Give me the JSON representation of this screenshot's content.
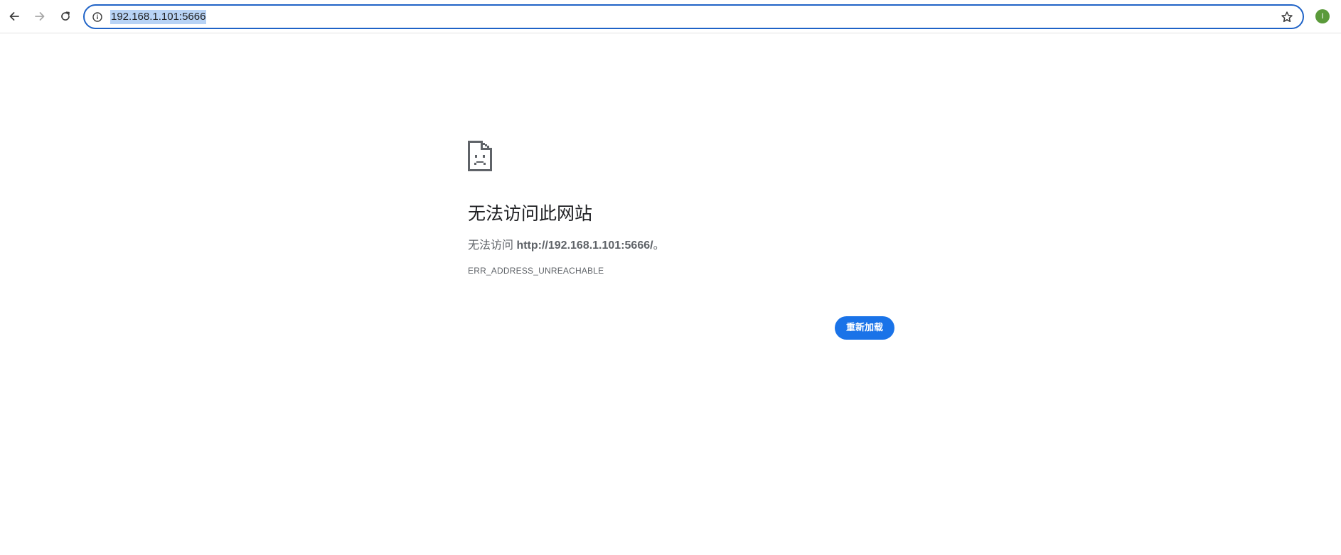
{
  "browser": {
    "url": "192.168.1.101:5666",
    "profile_initial": "I",
    "accent_color": "#1a73e8",
    "icons": {
      "back": "arrow-left",
      "forward": "arrow-right",
      "reload": "refresh",
      "site_info": "info-circle",
      "bookmark": "star-outline"
    }
  },
  "error_page": {
    "icon": "sad-document",
    "title": "无法访问此网站",
    "description_prefix": "无法访问 ",
    "description_url": "http://192.168.1.101:5666/",
    "description_suffix": "。",
    "error_code": "ERR_ADDRESS_UNREACHABLE",
    "reload_label": "重新加载"
  }
}
